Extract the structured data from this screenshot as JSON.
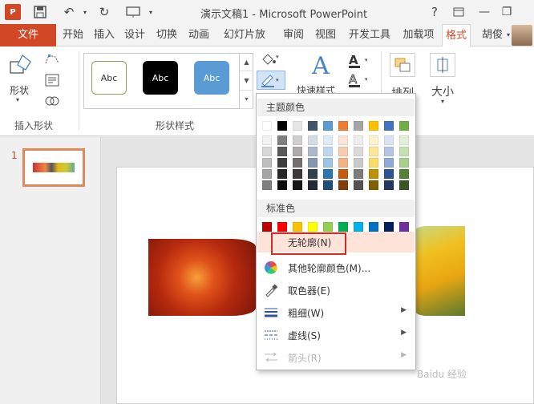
{
  "window": {
    "title": "演示文稿1 - Microsoft PowerPoint",
    "logo_text": "P"
  },
  "tabs": [
    {
      "label": "文件"
    },
    {
      "label": "开始"
    },
    {
      "label": "插入"
    },
    {
      "label": "设计"
    },
    {
      "label": "切换"
    },
    {
      "label": "动画"
    },
    {
      "label": "幻灯片放"
    },
    {
      "label": "审阅"
    },
    {
      "label": "视图"
    },
    {
      "label": "开发工具"
    },
    {
      "label": "加载项"
    },
    {
      "label": "格式"
    }
  ],
  "user": {
    "name": "胡俊"
  },
  "ribbon": {
    "insert_shapes": {
      "shapes_label": "形状",
      "group_label": "插入形状"
    },
    "shape_styles": {
      "group_label": "形状样式",
      "style_samples": [
        {
          "label": "Abc",
          "bg": "#ffffff",
          "fg": "#333333",
          "border": "#8aa05a"
        },
        {
          "label": "Abc",
          "bg": "#000000",
          "fg": "#ffffff",
          "border": "#000000"
        },
        {
          "label": "Abc",
          "bg": "#5b9bd5",
          "fg": "#ffffff",
          "border": "#5b9bd5"
        }
      ]
    },
    "wordart": {
      "quick_styles_label": "快速样式"
    },
    "arrange_label": "排列",
    "size_label": "大小"
  },
  "slides_pane": {
    "slide_number": "1"
  },
  "outline_menu": {
    "theme_colors_header": "主题颜色",
    "standard_colors_header": "标准色",
    "theme_top_row": [
      "#ffffff",
      "#000000",
      "#e7e6e6",
      "#44546a",
      "#5b9bd5",
      "#ed7d31",
      "#a5a5a5",
      "#ffc000",
      "#4472c4",
      "#70ad47"
    ],
    "theme_shades": [
      [
        "#f2f2f2",
        "#7f7f7f",
        "#d0cece",
        "#d6dce4",
        "#deeaf6",
        "#fbe5d5",
        "#ededed",
        "#fff2cc",
        "#dae3f3",
        "#e2efd9"
      ],
      [
        "#d8d8d8",
        "#595959",
        "#aeabab",
        "#adb9ca",
        "#bdd7ee",
        "#f7cbac",
        "#dbdbdb",
        "#fee599",
        "#b4c6e7",
        "#c5e0b3"
      ],
      [
        "#bfbfbf",
        "#3f3f3f",
        "#757070",
        "#8496b0",
        "#9cc3e5",
        "#f4b183",
        "#c9c9c9",
        "#ffd965",
        "#8eaadb",
        "#a8d08d"
      ],
      [
        "#a5a5a5",
        "#262626",
        "#3a3838",
        "#323f4f",
        "#2e75b5",
        "#c55a11",
        "#7b7b7b",
        "#bf9000",
        "#2f5496",
        "#538135"
      ],
      [
        "#7f7f7f",
        "#0c0c0c",
        "#171616",
        "#222a35",
        "#1e4e79",
        "#833c0b",
        "#525252",
        "#7f6000",
        "#1f3864",
        "#375623"
      ]
    ],
    "standard_colors": [
      "#c00000",
      "#ff0000",
      "#ffc000",
      "#ffff00",
      "#92d050",
      "#00b050",
      "#00b0f0",
      "#0070c0",
      "#002060",
      "#7030a0"
    ],
    "items": [
      {
        "label": "无轮廓(N)",
        "icon": "no-outline-icon"
      },
      {
        "label": "其他轮廓颜色(M)...",
        "icon": "color-wheel-icon"
      },
      {
        "label": "取色器(E)",
        "icon": "eyedropper-icon"
      },
      {
        "label": "粗细(W)",
        "icon": "weight-icon"
      },
      {
        "label": "虚线(S)",
        "icon": "dashes-icon"
      },
      {
        "label": "箭头(R)",
        "icon": "arrows-icon"
      }
    ]
  },
  "watermark": {
    "text": "Baidu 经验"
  }
}
